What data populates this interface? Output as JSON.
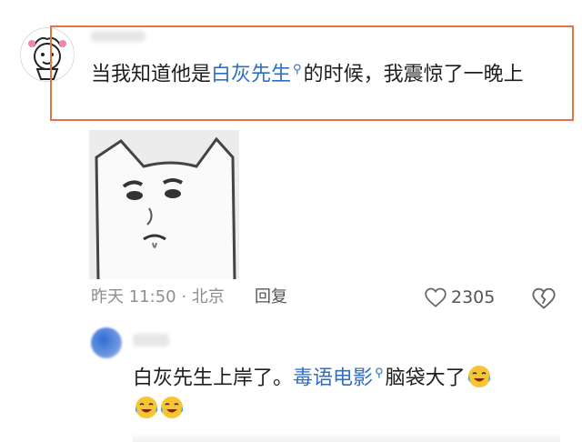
{
  "comments": [
    {
      "text_before": "当我知道他是",
      "link_text": "白灰先生",
      "text_after": "的时候，我震惊了一晚上",
      "time_location": "昨天 11:50 · 北京",
      "reply_label": "回复",
      "like_count": "2305"
    }
  ],
  "reply": {
    "text_before": "白灰先生上岸了。",
    "link_text": "毒语电影",
    "text_after": "脑袋大了"
  },
  "icons": {
    "link_search": "search-icon",
    "like": "heart-outline-icon",
    "dislike": "broken-heart-icon",
    "emoji": "laughing-crying-emoji"
  },
  "colors": {
    "link": "#2f6ec5",
    "highlight_box": "#e5734a"
  }
}
